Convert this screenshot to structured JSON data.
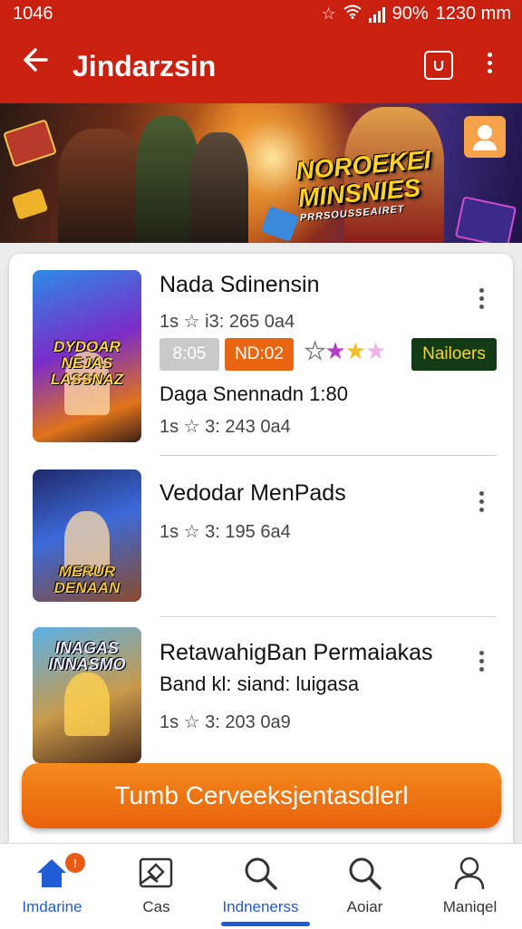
{
  "status_bar": {
    "time": "1046",
    "battery": "90%",
    "right_text": "1230 mm"
  },
  "app_bar": {
    "title": "Jindarzsin"
  },
  "banner": {
    "logo_line1": "NOROEKEI",
    "logo_line2": "MINSNIES",
    "logo_sub": "PRRSOUSSEAIRET"
  },
  "items": [
    {
      "name": "Nada Sdinensin",
      "meta": "1s ☆ i3: 265 0a4",
      "chips": [
        "8:05",
        "ND:02",
        "Nailoers"
      ],
      "detail": "Daga Snennadn 1:80",
      "meta2": "1s ☆ 3: 243 0a4",
      "thumb_title": "DYDOAR NEJAS LASSNAZ"
    },
    {
      "name": "Vedodar MenPads",
      "meta": "1s ☆ 3: 195 6a4",
      "thumb_title": "MERUR DENAAN"
    },
    {
      "name": "RetawahigBan Permaiakas",
      "detail": "Band kl: siand: luigasa",
      "meta": "1s ☆ 3: 203 0a9",
      "thumb_title": "INAGAS INNASMO"
    }
  ],
  "cta": {
    "label": "Tumb Cerveeksjentasdlerl"
  },
  "bottom_nav": [
    {
      "label": "Imdarine",
      "badge": "!"
    },
    {
      "label": "Cas"
    },
    {
      "label": "Indnenerss"
    },
    {
      "label": "Aoiar"
    },
    {
      "label": "Maniqel"
    }
  ],
  "colors": {
    "primary": "#c9200f",
    "accent": "#ea6512",
    "nav_active": "#1f5cd6"
  },
  "icons": {
    "appbar": [
      "back-arrow-icon",
      "tab-switch-icon",
      "more-vert-icon"
    ],
    "nav": [
      "home-icon",
      "photo-icon",
      "search-icon",
      "search-icon",
      "person-icon"
    ]
  }
}
